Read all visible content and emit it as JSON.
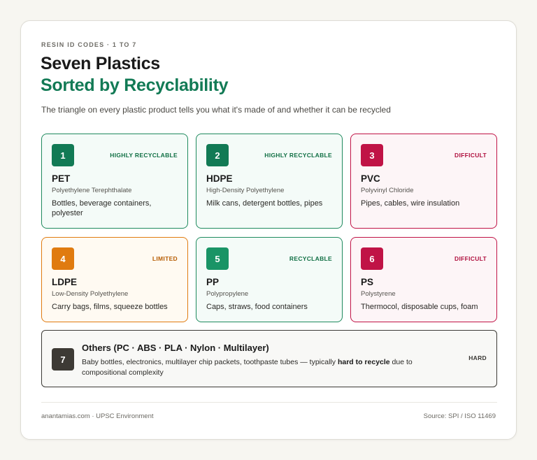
{
  "header": {
    "eyebrow": "RESIN ID CODES · 1 TO 7",
    "title_line1": "Seven Plastics",
    "title_line2": "Sorted by Recyclability",
    "subtitle": "The triangle on every plastic product tells you what it's made of and whether it can be recycled"
  },
  "colors": {
    "green": "#127a55",
    "green_badge": "#117045",
    "red": "#c01346",
    "orange": "#e07b10",
    "dark": "#3d3a35"
  },
  "plastics": [
    {
      "number": "1",
      "badge": "HIGHLY RECYCLABLE",
      "code": "PET",
      "fullname": "Polyethylene Terephthalate",
      "uses": "Bottles, beverage containers, polyester"
    },
    {
      "number": "2",
      "badge": "HIGHLY RECYCLABLE",
      "code": "HDPE",
      "fullname": "High-Density Polyethylene",
      "uses": "Milk cans, detergent bottles, pipes"
    },
    {
      "number": "3",
      "badge": "DIFFICULT",
      "code": "PVC",
      "fullname": "Polyvinyl Chloride",
      "uses": "Pipes, cables, wire insulation"
    },
    {
      "number": "4",
      "badge": "LIMITED",
      "code": "LDPE",
      "fullname": "Low-Density Polyethylene",
      "uses": "Carry bags, films, squeeze bottles"
    },
    {
      "number": "5",
      "badge": "RECYCLABLE",
      "code": "PP",
      "fullname": "Polypropylene",
      "uses": "Caps, straws, food containers"
    },
    {
      "number": "6",
      "badge": "DIFFICULT",
      "code": "PS",
      "fullname": "Polystyrene",
      "uses": "Thermocol, disposable cups, foam"
    }
  ],
  "others": {
    "number": "7",
    "title": "Others (PC · ABS · PLA · Nylon · Multilayer)",
    "desc_before": "Baby bottles, electronics, multilayer chip packets, toothpaste tubes — typically ",
    "desc_bold": "hard to recycle",
    "desc_after": " due to compositional complexity",
    "badge": "HARD"
  },
  "footer": {
    "left": "anantamias.com · UPSC Environment",
    "right": "Source: SPI / ISO 11469"
  }
}
